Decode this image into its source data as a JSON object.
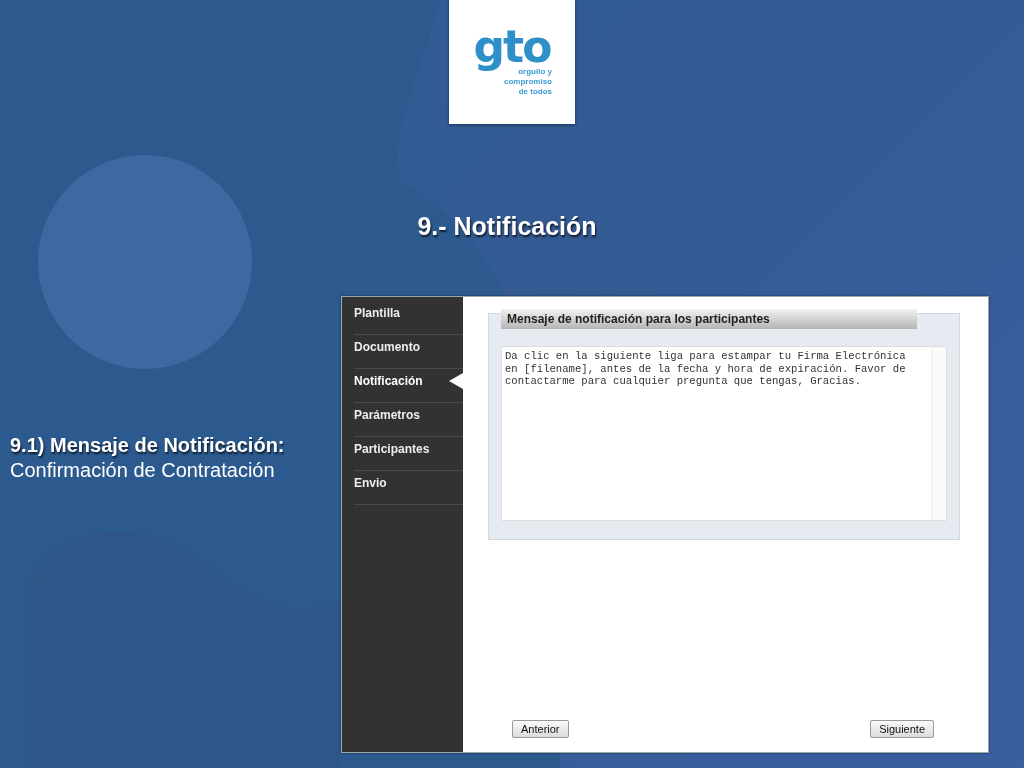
{
  "logo": {
    "wordmark": "gto",
    "tagline": "orgullo y compromiso de todos"
  },
  "title": "9.- Notificación",
  "caption": {
    "heading": "9.1) Mensaje de Notificación:",
    "text": "Confirmación de Contratación"
  },
  "app": {
    "sidebar": {
      "items": [
        {
          "label": "Plantilla",
          "selected": false
        },
        {
          "label": "Documento",
          "selected": false
        },
        {
          "label": "Notificación",
          "selected": true
        },
        {
          "label": "Parámetros",
          "selected": false
        },
        {
          "label": "Participantes",
          "selected": false
        },
        {
          "label": "Envio",
          "selected": false
        }
      ]
    },
    "panel_title": "Mensaje de notificación para los participantes",
    "message": "Da clic en la siguiente liga para estampar tu Firma Electrónica en [filename], antes de la fecha y hora de expiración. Favor de contactarme para cualquier pregunta que tengas, Gracias.",
    "buttons": [
      {
        "label": "Anterior"
      },
      {
        "label": "Siguiente"
      }
    ]
  }
}
